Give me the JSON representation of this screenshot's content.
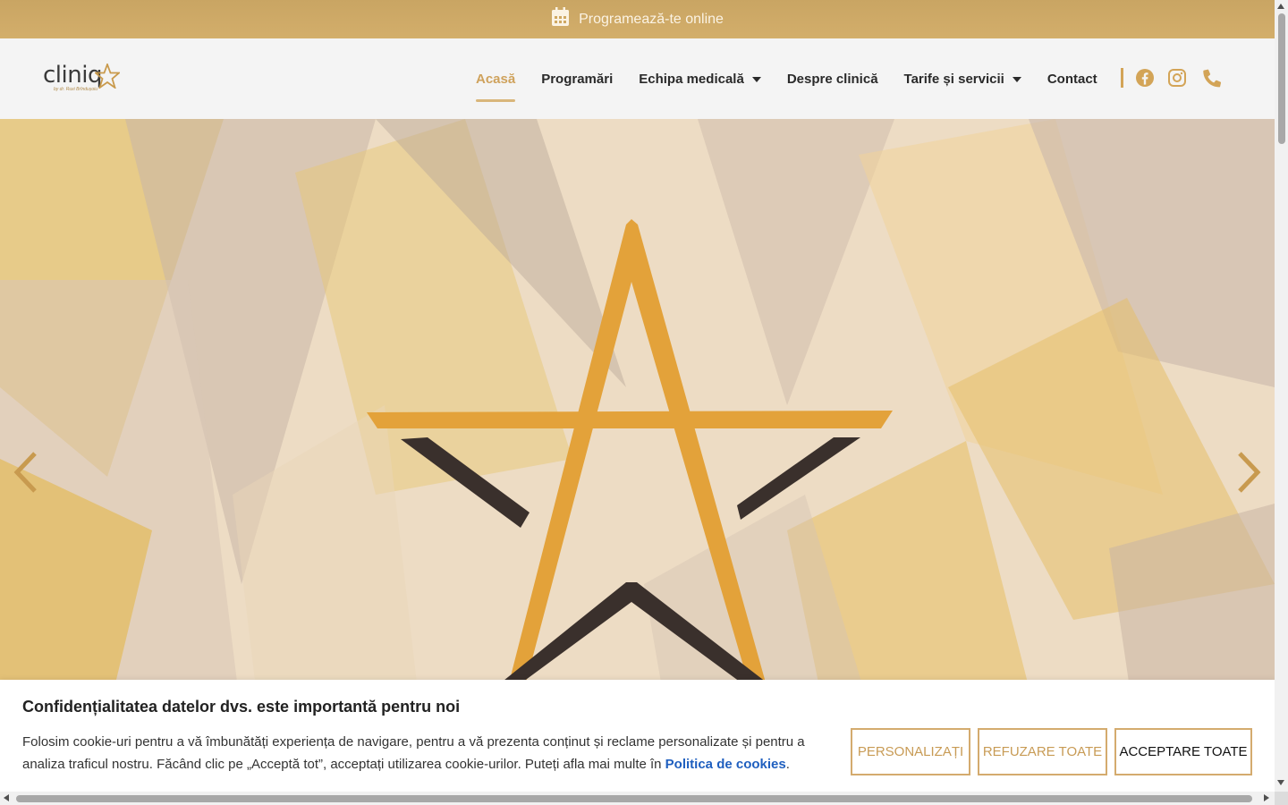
{
  "topbar": {
    "label": "Programează-te online",
    "icon": "calendar-icon"
  },
  "header": {
    "logo_text": "cliniq",
    "logo_sub": "by dr. Ruxi Brîndușoiu",
    "nav": [
      {
        "label": "Acasă",
        "active": true
      },
      {
        "label": "Programări"
      },
      {
        "label": "Echipa medicală",
        "dropdown": true
      },
      {
        "label": "Despre clinică"
      },
      {
        "label": "Tarife și servicii",
        "dropdown": true
      },
      {
        "label": "Contact"
      }
    ],
    "social_icons": [
      "facebook-icon",
      "instagram-icon",
      "phone-icon"
    ]
  },
  "hero": {
    "prev_icon": "chevron-left-icon",
    "next_icon": "chevron-right-icon"
  },
  "cookie": {
    "title": "Confidențialitatea datelor dvs. este importantă pentru noi",
    "text": "Folosim cookie-uri pentru a vă îmbunătăți experiența de navigare, pentru a vă prezenta conținut și reclame personalizate și pentru a analiza traficul nostru. Făcând clic pe „Acceptă tot”, acceptați utilizarea cookie-urilor. Puteți afla mai multe în ",
    "link": "Politica de cookies",
    "after_link": ".",
    "buttons": {
      "customize": "PERSONALIZAȚI",
      "reject": "REFUZARE TOATE",
      "accept": "ACCEPTARE TOATE"
    }
  },
  "colors": {
    "gold": "#d3ae6b",
    "accent": "#cfa25c",
    "link": "#1f5fbf"
  }
}
